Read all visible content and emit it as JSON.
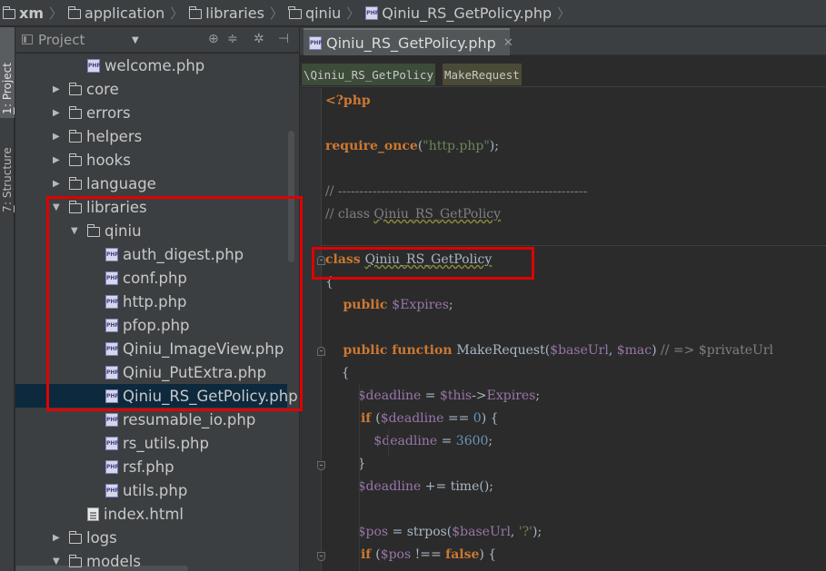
{
  "breadcrumb": [
    {
      "label": "xm",
      "icon": "folder-icon",
      "bold": true
    },
    {
      "label": "application",
      "icon": "folder-icon"
    },
    {
      "label": "libraries",
      "icon": "folder-icon"
    },
    {
      "label": "qiniu",
      "icon": "folder-icon"
    },
    {
      "label": "Qiniu_RS_GetPolicy.php",
      "icon": "php-file-icon"
    }
  ],
  "left_strip": {
    "project_tab": {
      "number": "1",
      "label": ": Project"
    },
    "structure_tab": {
      "number": "7",
      "label": ": Structure"
    }
  },
  "project_panel": {
    "title": "Project",
    "tree": [
      {
        "label": "welcome.php",
        "type": "php",
        "depth": 3
      },
      {
        "label": "core",
        "type": "folder",
        "depth": 2,
        "expanded": false
      },
      {
        "label": "errors",
        "type": "folder",
        "depth": 2,
        "expanded": false
      },
      {
        "label": "helpers",
        "type": "folder",
        "depth": 2,
        "expanded": false
      },
      {
        "label": "hooks",
        "type": "folder",
        "depth": 2,
        "expanded": false
      },
      {
        "label": "language",
        "type": "folder",
        "depth": 2,
        "expanded": false
      },
      {
        "label": "libraries",
        "type": "folder",
        "depth": 2,
        "expanded": true
      },
      {
        "label": "qiniu",
        "type": "folder",
        "depth": 3,
        "expanded": true
      },
      {
        "label": "auth_digest.php",
        "type": "php",
        "depth": 4
      },
      {
        "label": "conf.php",
        "type": "php",
        "depth": 4
      },
      {
        "label": "http.php",
        "type": "php",
        "depth": 4
      },
      {
        "label": "pfop.php",
        "type": "php",
        "depth": 4
      },
      {
        "label": "Qiniu_ImageView.php",
        "type": "php",
        "depth": 4
      },
      {
        "label": "Qiniu_PutExtra.php",
        "type": "php",
        "depth": 4
      },
      {
        "label": "Qiniu_RS_GetPolicy.php",
        "type": "php",
        "depth": 4,
        "selected": true
      },
      {
        "label": "resumable_io.php",
        "type": "php",
        "depth": 4
      },
      {
        "label": "rs_utils.php",
        "type": "php",
        "depth": 4
      },
      {
        "label": "rsf.php",
        "type": "php",
        "depth": 4
      },
      {
        "label": "utils.php",
        "type": "php",
        "depth": 4
      },
      {
        "label": "index.html",
        "type": "html",
        "depth": 3
      },
      {
        "label": "logs",
        "type": "folder",
        "depth": 2,
        "expanded": false
      },
      {
        "label": "models",
        "type": "folder",
        "depth": 2,
        "expanded": true
      }
    ]
  },
  "editor": {
    "tab_label": "Qiniu_RS_GetPolicy.php",
    "nav_class": "\\Qiniu_RS_GetPolicy",
    "nav_method": "MakeRequest",
    "code_lines": [
      [
        {
          "t": "<?php",
          "c": "tag"
        }
      ],
      [],
      [
        {
          "t": "require_once",
          "c": "kw"
        },
        {
          "t": "(",
          "c": "plain"
        },
        {
          "t": "\"http.php\"",
          "c": "str"
        },
        {
          "t": ");",
          "c": "plain"
        }
      ],
      [],
      [
        {
          "t": "// ----------------------------------------------------------",
          "c": "cm"
        }
      ],
      [
        {
          "t": "// class ",
          "c": "cm"
        },
        {
          "t": "Qiniu_RS_GetPolicy",
          "c": "cm wavy"
        }
      ],
      [],
      [
        {
          "t": "class ",
          "c": "kw"
        },
        {
          "t": "Qiniu_RS_GetPolicy",
          "c": "plain wavy"
        }
      ],
      [
        {
          "t": "{",
          "c": "plain"
        }
      ],
      [
        {
          "t": "    public ",
          "c": "kw"
        },
        {
          "t": "$Expires",
          "c": "var"
        },
        {
          "t": ";",
          "c": "plain"
        }
      ],
      [],
      [
        {
          "t": "    public function ",
          "c": "kw"
        },
        {
          "t": "MakeRequest(",
          "c": "plain"
        },
        {
          "t": "$baseUrl",
          "c": "var"
        },
        {
          "t": ", ",
          "c": "plain"
        },
        {
          "t": "$mac",
          "c": "var"
        },
        {
          "t": ") ",
          "c": "plain"
        },
        {
          "t": "// => $privateUrl",
          "c": "cm"
        }
      ],
      [
        {
          "t": "    {",
          "c": "plain"
        }
      ],
      [
        {
          "t": "        ",
          "c": "plain"
        },
        {
          "t": "$deadline",
          "c": "var"
        },
        {
          "t": " = ",
          "c": "plain"
        },
        {
          "t": "$this",
          "c": "var"
        },
        {
          "t": "->",
          "c": "plain"
        },
        {
          "t": "Expires",
          "c": "var"
        },
        {
          "t": ";",
          "c": "plain"
        }
      ],
      [
        {
          "t": "        if ",
          "c": "kw"
        },
        {
          "t": "(",
          "c": "plain"
        },
        {
          "t": "$deadline",
          "c": "var"
        },
        {
          "t": " == ",
          "c": "plain"
        },
        {
          "t": "0",
          "c": "num"
        },
        {
          "t": ") {",
          "c": "plain"
        }
      ],
      [
        {
          "t": "            ",
          "c": "plain"
        },
        {
          "t": "$deadline",
          "c": "var"
        },
        {
          "t": " = ",
          "c": "plain"
        },
        {
          "t": "3600",
          "c": "num"
        },
        {
          "t": ";",
          "c": "plain"
        }
      ],
      [
        {
          "t": "        }",
          "c": "plain"
        }
      ],
      [
        {
          "t": "        ",
          "c": "plain"
        },
        {
          "t": "$deadline",
          "c": "var"
        },
        {
          "t": " += time();",
          "c": "plain"
        }
      ],
      [],
      [
        {
          "t": "        ",
          "c": "plain"
        },
        {
          "t": "$pos",
          "c": "var"
        },
        {
          "t": " = strpos(",
          "c": "plain"
        },
        {
          "t": "$baseUrl",
          "c": "var"
        },
        {
          "t": ", ",
          "c": "plain"
        },
        {
          "t": "'?'",
          "c": "str"
        },
        {
          "t": ");",
          "c": "plain"
        }
      ],
      [
        {
          "t": "        if ",
          "c": "kw"
        },
        {
          "t": "(",
          "c": "plain"
        },
        {
          "t": "$pos",
          "c": "var"
        },
        {
          "t": " !== ",
          "c": "plain"
        },
        {
          "t": "false",
          "c": "kw"
        },
        {
          "t": ") {",
          "c": "plain"
        }
      ]
    ]
  },
  "colors": {
    "highlight_box": "#e00000",
    "selection": "#0d293e"
  }
}
